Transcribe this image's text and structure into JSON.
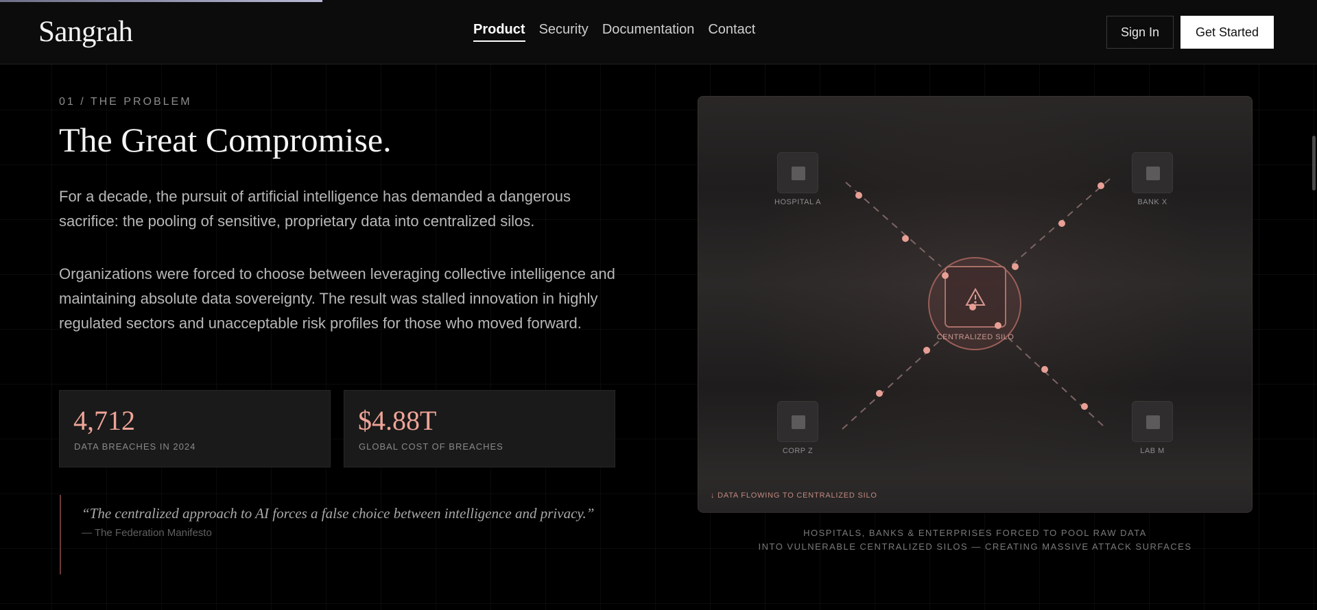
{
  "header": {
    "logo": "Sangrah",
    "nav": [
      {
        "label": "Product",
        "active": true
      },
      {
        "label": "Security",
        "active": false
      },
      {
        "label": "Documentation",
        "active": false
      },
      {
        "label": "Contact",
        "active": false
      }
    ],
    "sign_in": "Sign In",
    "get_started": "Get Started"
  },
  "section": {
    "kicker": "01 / THE PROBLEM",
    "title": "The Great Compromise.",
    "paragraph1": "For a decade, the pursuit of artificial intelligence has demanded a dangerous sacrifice: the pooling of sensitive, proprietary data into centralized silos.",
    "paragraph2": "Organizations were forced to choose between leveraging collective intelligence and maintaining absolute data sovereignty. The result was stalled innovation in highly regulated sectors and unacceptable risk profiles for those who moved forward.",
    "stats": [
      {
        "value": "4,712",
        "label": "DATA BREACHES IN 2024"
      },
      {
        "value": "$4.88T",
        "label": "GLOBAL COST OF BREACHES"
      }
    ],
    "quote": {
      "text": "“The centralized approach to AI forces a false choice between intelligence and privacy.”",
      "source": "— The Federation Manifesto"
    }
  },
  "diagram": {
    "nodes": {
      "top_left": "HOSPITAL A",
      "top_right": "BANK X",
      "bottom_left": "CORP Z",
      "bottom_right": "LAB M"
    },
    "center": "CENTRALIZED SILO",
    "center_icon": "warning-icon",
    "footer": "↓ DATA FLOWING TO CENTRALIZED SILO",
    "caption_line1": "HOSPITALS, BANKS & ENTERPRISES FORCED TO POOL RAW DATA",
    "caption_line2": "INTO VULNERABLE CENTRALIZED SILOS — CREATING MASSIVE ATTACK SURFACES"
  },
  "colors": {
    "accent": "#f0a498",
    "background": "#000000",
    "silo_stroke": "#9a5f58"
  }
}
